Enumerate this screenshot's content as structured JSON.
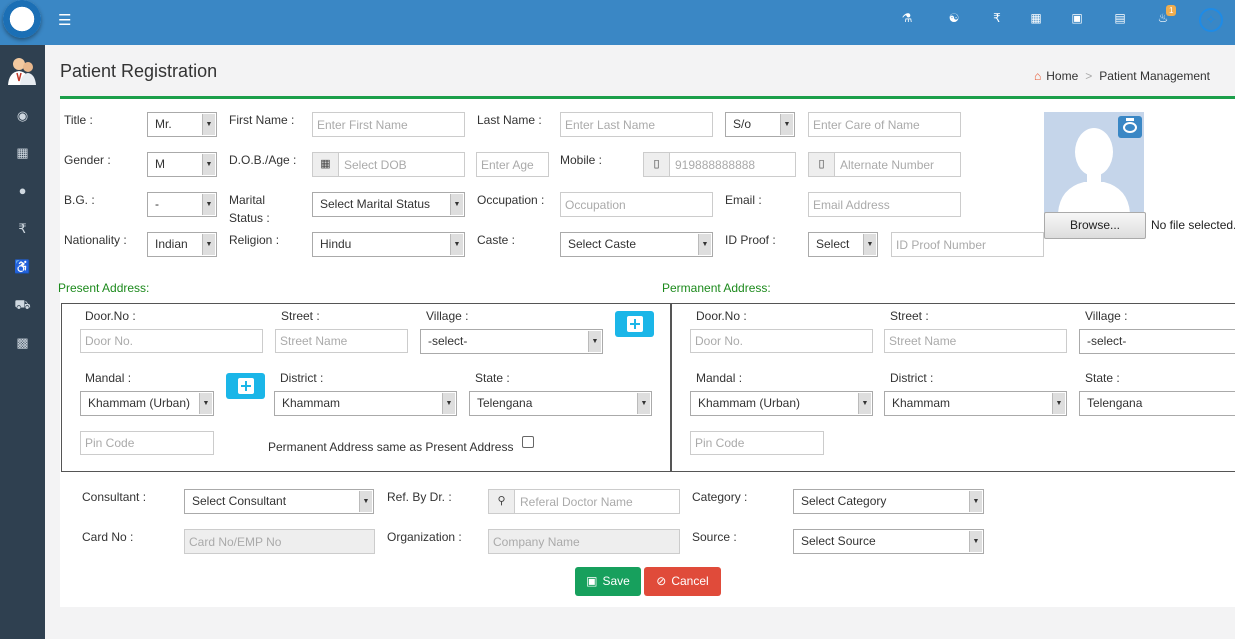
{
  "topbar": {
    "menu_icon": "bars-icon",
    "icons": [
      "medicine-icon",
      "handshake-icon",
      "rupee-icon",
      "calendar-icon",
      "hospital-icon",
      "money-icon",
      "bell-icon"
    ],
    "notification_count": "1",
    "settings_icon": "crosshair-gear-icon"
  },
  "page_title": "Patient Registration",
  "breadcrumb": {
    "home": "Home",
    "current": "Patient Management"
  },
  "form": {
    "title_label": "Title :",
    "title_value": "Mr.",
    "first_name_label": "First Name :",
    "first_name_placeholder": "Enter First Name",
    "last_name_label": "Last Name :",
    "last_name_placeholder": "Enter Last Name",
    "relation_value": "S/o",
    "care_of_placeholder": "Enter Care of Name",
    "gender_label": "Gender :",
    "gender_value": "M",
    "dob_label": "D.O.B./Age :",
    "dob_placeholder": "Select DOB",
    "age_placeholder": "Enter Age",
    "mobile_label": "Mobile :",
    "mobile_placeholder": "919888888888",
    "alt_number_placeholder": "Alternate Number",
    "bg_label": "B.G. :",
    "bg_value": "-",
    "marital_label_1": "Marital",
    "marital_label_2": "Status :",
    "marital_value": "Select Marital Status",
    "occupation_label": "Occupation :",
    "occupation_placeholder": "Occupation",
    "email_label": "Email :",
    "email_placeholder": "Email Address",
    "nationality_label": "Nationality :",
    "nationality_value": "Indian",
    "religion_label": "Religion :",
    "religion_value": "Hindu",
    "caste_label": "Caste :",
    "caste_value": "Select Caste",
    "id_proof_label": "ID Proof :",
    "id_proof_value": "Select",
    "id_proof_placeholder": "ID Proof Number",
    "browse_label": "Browse...",
    "no_file": "No file selected."
  },
  "present_address": {
    "title": "Present Address:",
    "door_label": "Door.No :",
    "door_placeholder": "Door No.",
    "street_label": "Street :",
    "street_placeholder": "Street Name",
    "village_label": "Village :",
    "village_value": "-select-",
    "mandal_label": "Mandal :",
    "mandal_value": "Khammam (Urban)",
    "district_label": "District :",
    "district_value": "Khammam",
    "state_label": "State :",
    "state_value": "Telengana",
    "pin_placeholder": "Pin Code",
    "same_label": "Permanent Address same as Present Address"
  },
  "permanent_address": {
    "title": "Permanent Address:",
    "door_label": "Door.No :",
    "door_placeholder": "Door No.",
    "street_label": "Street :",
    "street_placeholder": "Street Name",
    "village_label": "Village :",
    "village_value": "-select-",
    "mandal_label": "Mandal :",
    "mandal_value": "Khammam (Urban)",
    "district_label": "District :",
    "district_value": "Khammam",
    "state_label": "State :",
    "state_value": "Telengana",
    "pin_placeholder": "Pin Code"
  },
  "footer_form": {
    "consultant_label": "Consultant :",
    "consultant_value": "Select Consultant",
    "ref_label": "Ref. By Dr. :",
    "ref_placeholder": "Referal Doctor Name",
    "category_label": "Category :",
    "category_value": "Select Category",
    "card_label": "Card No :",
    "card_placeholder": "Card No/EMP No",
    "org_label": "Organization :",
    "org_placeholder": "Company Name",
    "source_label": "Source :",
    "source_value": "Select Source"
  },
  "actions": {
    "save": "Save",
    "cancel": "Cancel",
    "save_color": "#17a05d",
    "cancel_color": "#e04b3a"
  },
  "colors": {
    "topbar": "#3a87c5",
    "sidebar": "#2f4050",
    "accent_green": "#1c9f4a",
    "plus_button": "#1bb6e8"
  }
}
